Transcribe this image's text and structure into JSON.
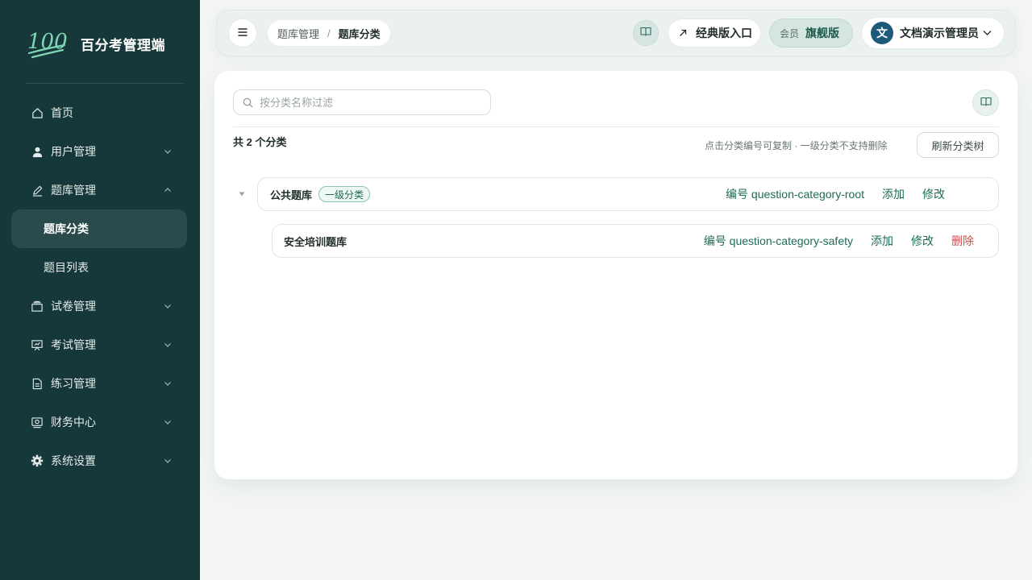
{
  "brand": {
    "logo_text": "100",
    "title": "百分考管理端"
  },
  "sidebar": {
    "items": [
      {
        "label": "首页",
        "icon": "home-icon"
      },
      {
        "label": "用户管理",
        "icon": "user-icon"
      },
      {
        "label": "题库管理",
        "icon": "edit-icon"
      },
      {
        "label": "题库分类"
      },
      {
        "label": "题目列表"
      },
      {
        "label": "试卷管理",
        "icon": "paper-stack-icon"
      },
      {
        "label": "考试管理",
        "icon": "presentation-icon"
      },
      {
        "label": "练习管理",
        "icon": "document-icon"
      },
      {
        "label": "财务中心",
        "icon": "finance-icon"
      },
      {
        "label": "系统设置",
        "icon": "gear-icon"
      }
    ]
  },
  "header": {
    "breadcrumb": {
      "parent": "题库管理",
      "separator": "/",
      "current": "题库分类"
    },
    "classic_label": "经典版入口",
    "member_label": "会员",
    "member_tier": "旗舰版",
    "avatar_text": "文",
    "user_name": "文档演示管理员"
  },
  "main": {
    "search_placeholder": "按分类名称过滤",
    "count_text": "共 2 个分类",
    "hint": "点击分类编号可复制 · 一级分类不支持删除",
    "refresh_label": "刷新分类树",
    "tree": [
      {
        "name": "公共题库",
        "badge": "一级分类",
        "code": "编号 question-category-root",
        "actions": {
          "add": "添加",
          "edit": "修改"
        }
      },
      {
        "name": "安全培训题库",
        "code": "编号 question-category-safety",
        "actions": {
          "add": "添加",
          "edit": "修改",
          "delete": "删除"
        }
      }
    ]
  },
  "colors": {
    "sidebar_bg": "#17383a",
    "accent": "#1d6b57",
    "danger": "#d04a4a",
    "logo": "#7fd6b3"
  }
}
